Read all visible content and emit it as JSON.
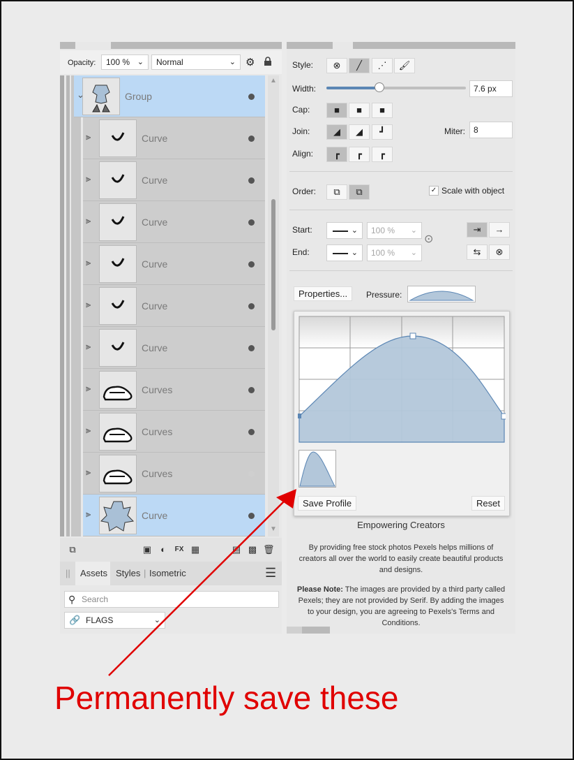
{
  "layers": {
    "opacity_label": "Opacity:",
    "opacity_value": "100 %",
    "blend_mode": "Normal",
    "rows": [
      {
        "label": "Group",
        "icon": "group-figure-thumb",
        "selected": true
      },
      {
        "label": "Curve",
        "icon": "curve-thumb"
      },
      {
        "label": "Curve",
        "icon": "curve-thumb"
      },
      {
        "label": "Curve",
        "icon": "curve-thumb"
      },
      {
        "label": "Curve",
        "icon": "curve-thumb"
      },
      {
        "label": "Curve",
        "icon": "curve-thumb"
      },
      {
        "label": "Curve",
        "icon": "curve-thumb"
      },
      {
        "label": "Curves",
        "icon": "shoe-thumb"
      },
      {
        "label": "Curves",
        "icon": "shoe-thumb"
      },
      {
        "label": "Curves",
        "icon": "shoe-thumb"
      },
      {
        "label": "Curve",
        "icon": "star-shape-thumb",
        "selected": true
      }
    ]
  },
  "assets": {
    "tabs": [
      "Assets",
      "Styles",
      "Isometric"
    ],
    "search_placeholder": "Search",
    "category": "FLAGS"
  },
  "stroke": {
    "style_label": "Style:",
    "width_label": "Width:",
    "width_value": "7.6 px",
    "width_fraction": 0.38,
    "cap_label": "Cap:",
    "join_label": "Join:",
    "miter_label": "Miter:",
    "miter_value": "8",
    "align_label": "Align:",
    "order_label": "Order:",
    "scale_label": "Scale with object",
    "start_label": "Start:",
    "end_label": "End:",
    "start_pct": "100 %",
    "end_pct": "100 %",
    "properties_button": "Properties...",
    "pressure_label": "Pressure:"
  },
  "pressure_popup": {
    "save_profile": "Save Profile",
    "reset": "Reset"
  },
  "pexels": {
    "heading": "Empowering Creators",
    "body": "By providing free stock photos Pexels helps millions of creators all over the world to easily create beautiful products and designs.",
    "note_bold": "Please Note:",
    "note": " The images are provided by a third party called Pexels; they are not provided by Serif. By adding the images to your design, you are agreeing to Pexels's Terms and Conditions."
  },
  "annotation": {
    "caption": "Permanently save these",
    "color": "#e00000"
  },
  "colors": {
    "selection": "#bcd9f5",
    "curve_fill": "#b3c7da",
    "curve_stroke": "#5b86b4"
  }
}
